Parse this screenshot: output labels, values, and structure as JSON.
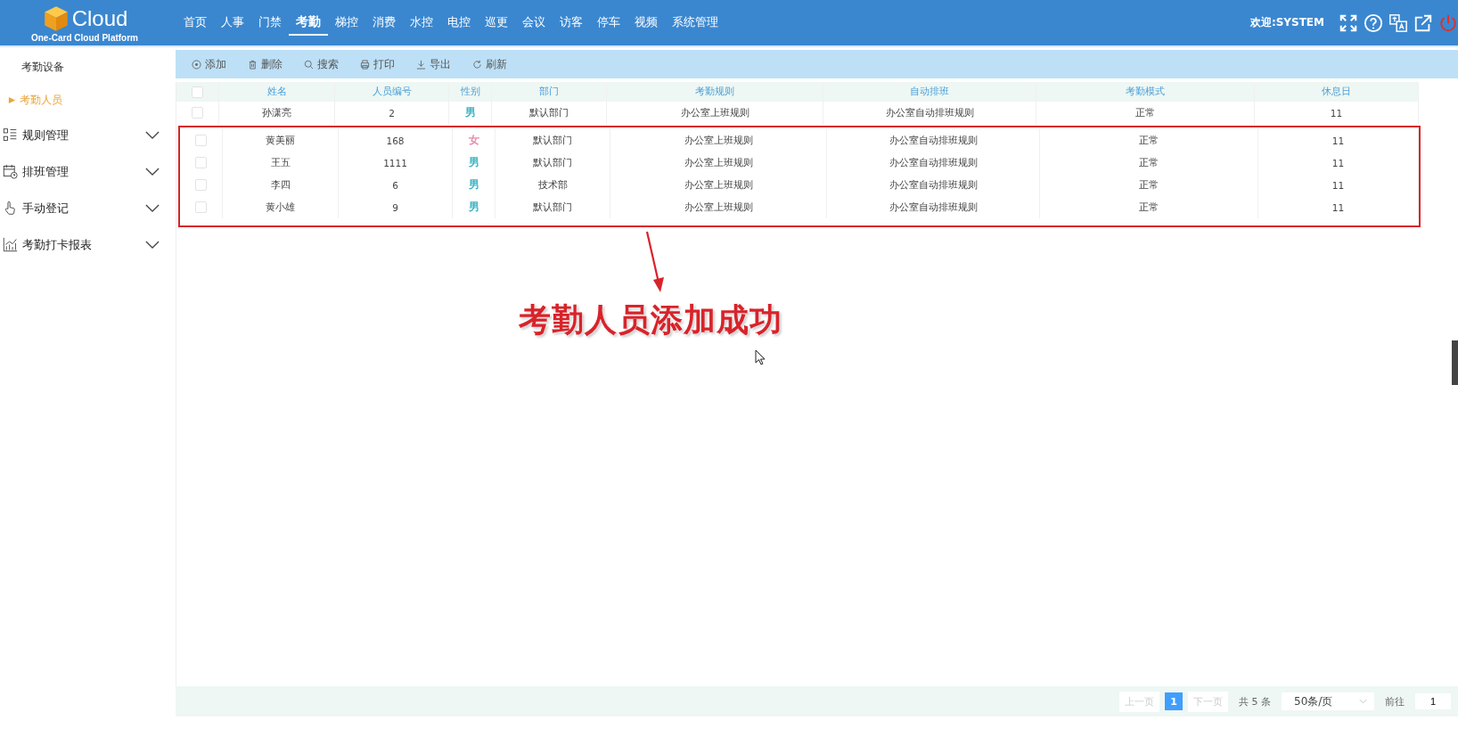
{
  "header": {
    "logo_title": "Cloud",
    "logo_subtitle": "One-Card Cloud Platform",
    "nav": [
      {
        "label": "首页",
        "selected": false
      },
      {
        "label": "人事",
        "selected": false
      },
      {
        "label": "门禁",
        "selected": false
      },
      {
        "label": "考勤",
        "selected": true
      },
      {
        "label": "梯控",
        "selected": false
      },
      {
        "label": "消费",
        "selected": false
      },
      {
        "label": "水控",
        "selected": false
      },
      {
        "label": "电控",
        "selected": false
      },
      {
        "label": "巡更",
        "selected": false
      },
      {
        "label": "会议",
        "selected": false
      },
      {
        "label": "访客",
        "selected": false
      },
      {
        "label": "停车",
        "selected": false
      },
      {
        "label": "视频",
        "selected": false
      },
      {
        "label": "系统管理",
        "selected": false
      }
    ],
    "welcome": "欢迎:SYSTEM"
  },
  "sidebar": {
    "items": [
      {
        "label": "考勤设备",
        "selected": false
      },
      {
        "label": "考勤人员",
        "selected": true
      }
    ],
    "groups": [
      {
        "label": "规则管理",
        "expanded": false
      },
      {
        "label": "排班管理",
        "expanded": false
      },
      {
        "label": "手动登记",
        "expanded": false
      },
      {
        "label": "考勤打卡报表",
        "expanded": false
      }
    ]
  },
  "toolbar": [
    "添加",
    "删除",
    "搜索",
    "打印",
    "导出",
    "刷新"
  ],
  "table": {
    "select_all_checked": false,
    "columns": [
      "姓名",
      "人员编号",
      "性别",
      "部门",
      "考勤规则",
      "自动排班",
      "考勤模式",
      "休息日"
    ],
    "rows": [
      {
        "checked": false,
        "highlighted": false,
        "color": "#3fb5c5",
        "cells": [
          "孙潇亮",
          "2",
          "男",
          "默认部门",
          "办公室上班规则",
          "办公室自动排班规则",
          "正常",
          "11"
        ]
      },
      {
        "checked": false,
        "highlighted": true,
        "color": "#e58fb0",
        "cells": [
          "黄美丽",
          "168",
          "女",
          "默认部门",
          "办公室上班规则",
          "办公室自动排班规则",
          "正常",
          "11"
        ]
      },
      {
        "checked": false,
        "highlighted": true,
        "color": "#3fb5c5",
        "cells": [
          "王五",
          "1111",
          "男",
          "默认部门",
          "办公室上班规则",
          "办公室自动排班规则",
          "正常",
          "11"
        ]
      },
      {
        "checked": false,
        "highlighted": true,
        "color": "#3fb5c5",
        "cells": [
          "李四",
          "6",
          "男",
          "技术部",
          "办公室上班规则",
          "办公室自动排班规则",
          "正常",
          "11"
        ]
      },
      {
        "checked": false,
        "highlighted": true,
        "color": "#3fb5c5",
        "cells": [
          "黄小雄",
          "9",
          "男",
          "默认部门",
          "办公室上班规则",
          "办公室自动排班规则",
          "正常",
          "11"
        ]
      }
    ]
  },
  "annotation": {
    "text": "考勤人员添加成功"
  },
  "pagination": {
    "prev": "上一页",
    "pages": [
      {
        "label": "1",
        "selected": true
      }
    ],
    "next": "下一页",
    "total": "共 5 条",
    "page_size": "50条/页",
    "goto_label": "前往",
    "goto_value": "1"
  }
}
